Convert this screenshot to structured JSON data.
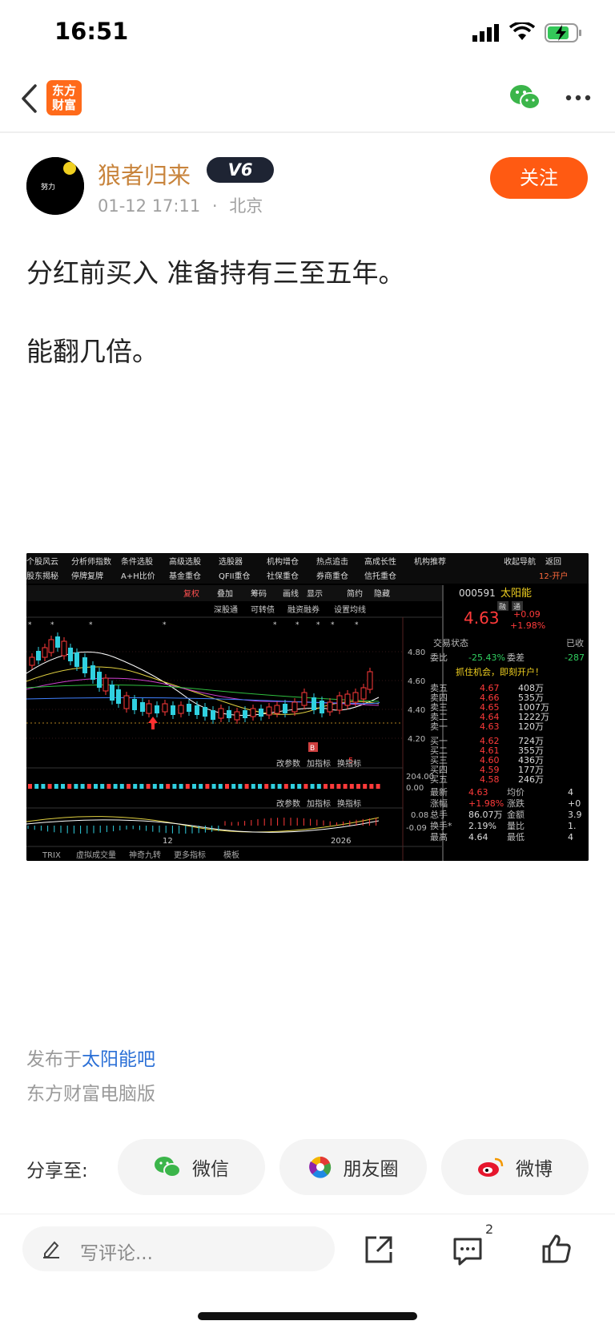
{
  "status": {
    "time": "16:51"
  },
  "nav": {
    "brand_text": "东方财富"
  },
  "post": {
    "username": "狼者归来",
    "level_badge": "V6",
    "date": "01-12 17:11",
    "location": "北京",
    "follow_label": "关注",
    "avatar_text": "努力",
    "line1": "分红前买入 准备持有三至五年。",
    "line2": "能翻几倍。"
  },
  "screenshot": {
    "menu_row1": [
      "个股风云",
      "分析师指数",
      "条件选股",
      "高级选股",
      "选股器",
      "机构增仓",
      "热点追击",
      "高成长性",
      "机构推荐",
      "收起导航",
      "返回"
    ],
    "menu_row2": [
      "股东揭秘",
      "停牌复牌",
      "A+H比价",
      "基金重仓",
      "QFII重仓",
      "社保重仓",
      "券商重仓",
      "信托重仓",
      "12-开户"
    ],
    "toolbar": [
      "复权",
      "叠加",
      "筹码",
      "画线",
      "显示",
      "简约",
      "隐藏"
    ],
    "subtoolbar": [
      "深股通",
      "可转债",
      "融资融券",
      "设置均线"
    ],
    "price_ticks": [
      "4.80",
      "4.60",
      "4.40",
      "4.20"
    ],
    "panel_labels": [
      "改参数",
      "加指标",
      "换指标"
    ],
    "vol_ticks": [
      "204.00",
      "0.00"
    ],
    "macd_ticks": [
      "0.08",
      "-0.09"
    ],
    "x_ticks": [
      "12",
      "2026"
    ],
    "bottom_tabs": [
      "TRIX",
      "虚拟成交量",
      "神奇九转",
      "更多指标",
      "模板"
    ],
    "markers": {
      "b": "B",
      "five": "5"
    },
    "quote": {
      "code": "000591",
      "name": "太阳能",
      "tag1": "融",
      "tag2": "通",
      "price": "4.63",
      "change": "+0.09",
      "change_pct": "+1.98%",
      "trade_status_label": "交易状态",
      "trade_status": "已收",
      "weibi_label": "委比",
      "weibi": "-25.43%",
      "weicha_label": "委差",
      "weicha": "-287",
      "banner": "抓住机会，即刻开户！",
      "asks": [
        {
          "label": "卖五",
          "price": "4.67",
          "vol": "408万"
        },
        {
          "label": "卖四",
          "price": "4.66",
          "vol": "535万"
        },
        {
          "label": "卖三",
          "price": "4.65",
          "vol": "1007万"
        },
        {
          "label": "卖二",
          "price": "4.64",
          "vol": "1222万"
        },
        {
          "label": "卖一",
          "price": "4.63",
          "vol": "120万"
        }
      ],
      "bids": [
        {
          "label": "买一",
          "price": "4.62",
          "vol": "724万"
        },
        {
          "label": "买二",
          "price": "4.61",
          "vol": "355万"
        },
        {
          "label": "买三",
          "price": "4.60",
          "vol": "436万"
        },
        {
          "label": "买四",
          "price": "4.59",
          "vol": "177万"
        },
        {
          "label": "买五",
          "price": "4.58",
          "vol": "246万"
        }
      ],
      "stats": [
        {
          "l1": "最新",
          "v1": "4.63",
          "l2": "均价",
          "v2": "4"
        },
        {
          "l1": "涨幅",
          "v1": "+1.98%",
          "l2": "涨跌",
          "v2": "+0"
        },
        {
          "l1": "总手",
          "v1": "86.07万",
          "l2": "金额",
          "v2": "3.9"
        },
        {
          "l1": "换手*",
          "v1": "2.19%",
          "l2": "量比",
          "v2": "1."
        },
        {
          "l1": "最高",
          "v1": "4.64",
          "l2": "最低",
          "v2": "4"
        }
      ]
    }
  },
  "footer": {
    "published_prefix": "发布于",
    "forum": "太阳能吧",
    "client": "东方财富电脑版",
    "share_label": "分享至:",
    "share_wechat": "微信",
    "share_moments": "朋友圈",
    "share_weibo": "微博",
    "comment_placeholder": "写评论...",
    "comment_count": "2"
  },
  "colors": {
    "accent": "#ff5a12",
    "username": "#c8843c",
    "link": "#2a6fd6"
  }
}
